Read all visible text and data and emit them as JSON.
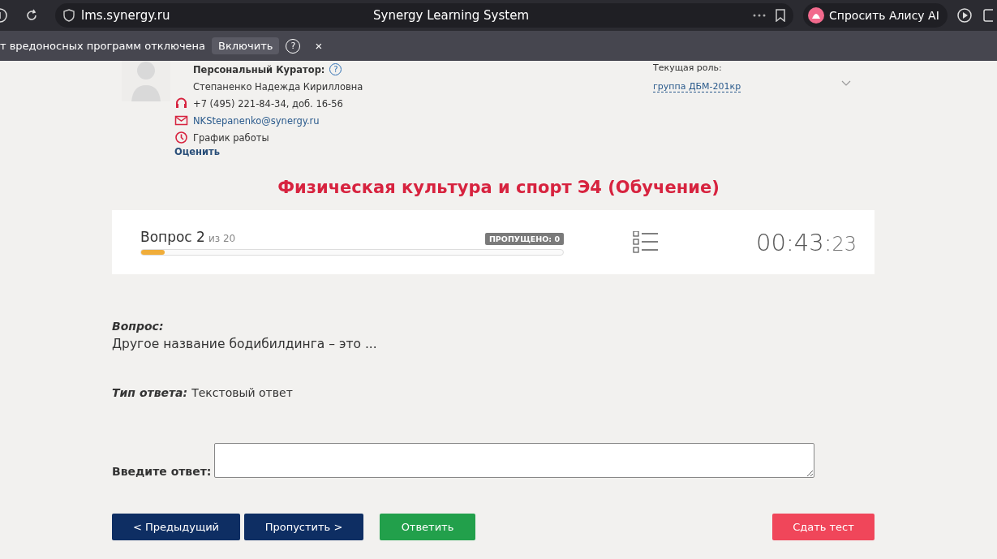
{
  "browser": {
    "url": "lms.synergy.ru",
    "title": "Synergy Learning System",
    "assistant_button": "Спросить Алису AI"
  },
  "notice_bar": {
    "text": "т вредоносных программ отключена",
    "button": "Включить",
    "help": "?",
    "close": "×"
  },
  "curator": {
    "heading": "Персональный Куратор:",
    "help": "?",
    "name": "Степаненко Надежда Кирилловна",
    "phone": "+7 (495) 221-84-34, доб. 16-56",
    "email": "NKStepanenko@synergy.ru",
    "schedule": "График работы",
    "rate_link": "Оценить"
  },
  "role": {
    "label": "Текущая роль:",
    "value": "группа ДБМ-201кр"
  },
  "course_title": "Физическая культура и спорт Э4 (Обучение)",
  "progress": {
    "question_label": "Вопрос 2",
    "of_total": "из 20",
    "skipped_badge": "ПРОПУЩЕНО: 0",
    "level": 0.055,
    "timer_main": "00:43:",
    "timer_seconds": "23"
  },
  "question": {
    "label": "Вопрос:",
    "text": "Другое название бодибилдинга – это ...",
    "type_label": "Тип ответа:",
    "type_value": "Текстовый ответ",
    "answer_label": "Введите ответ:"
  },
  "buttons": [
    {
      "label": "< Предыдущий",
      "kind": "nav"
    },
    {
      "label": "Пропустить >",
      "kind": "nav"
    },
    {
      "label": "Ответить",
      "kind": "submit"
    },
    {
      "label": "Сдать тест",
      "kind": "finish"
    }
  ]
}
